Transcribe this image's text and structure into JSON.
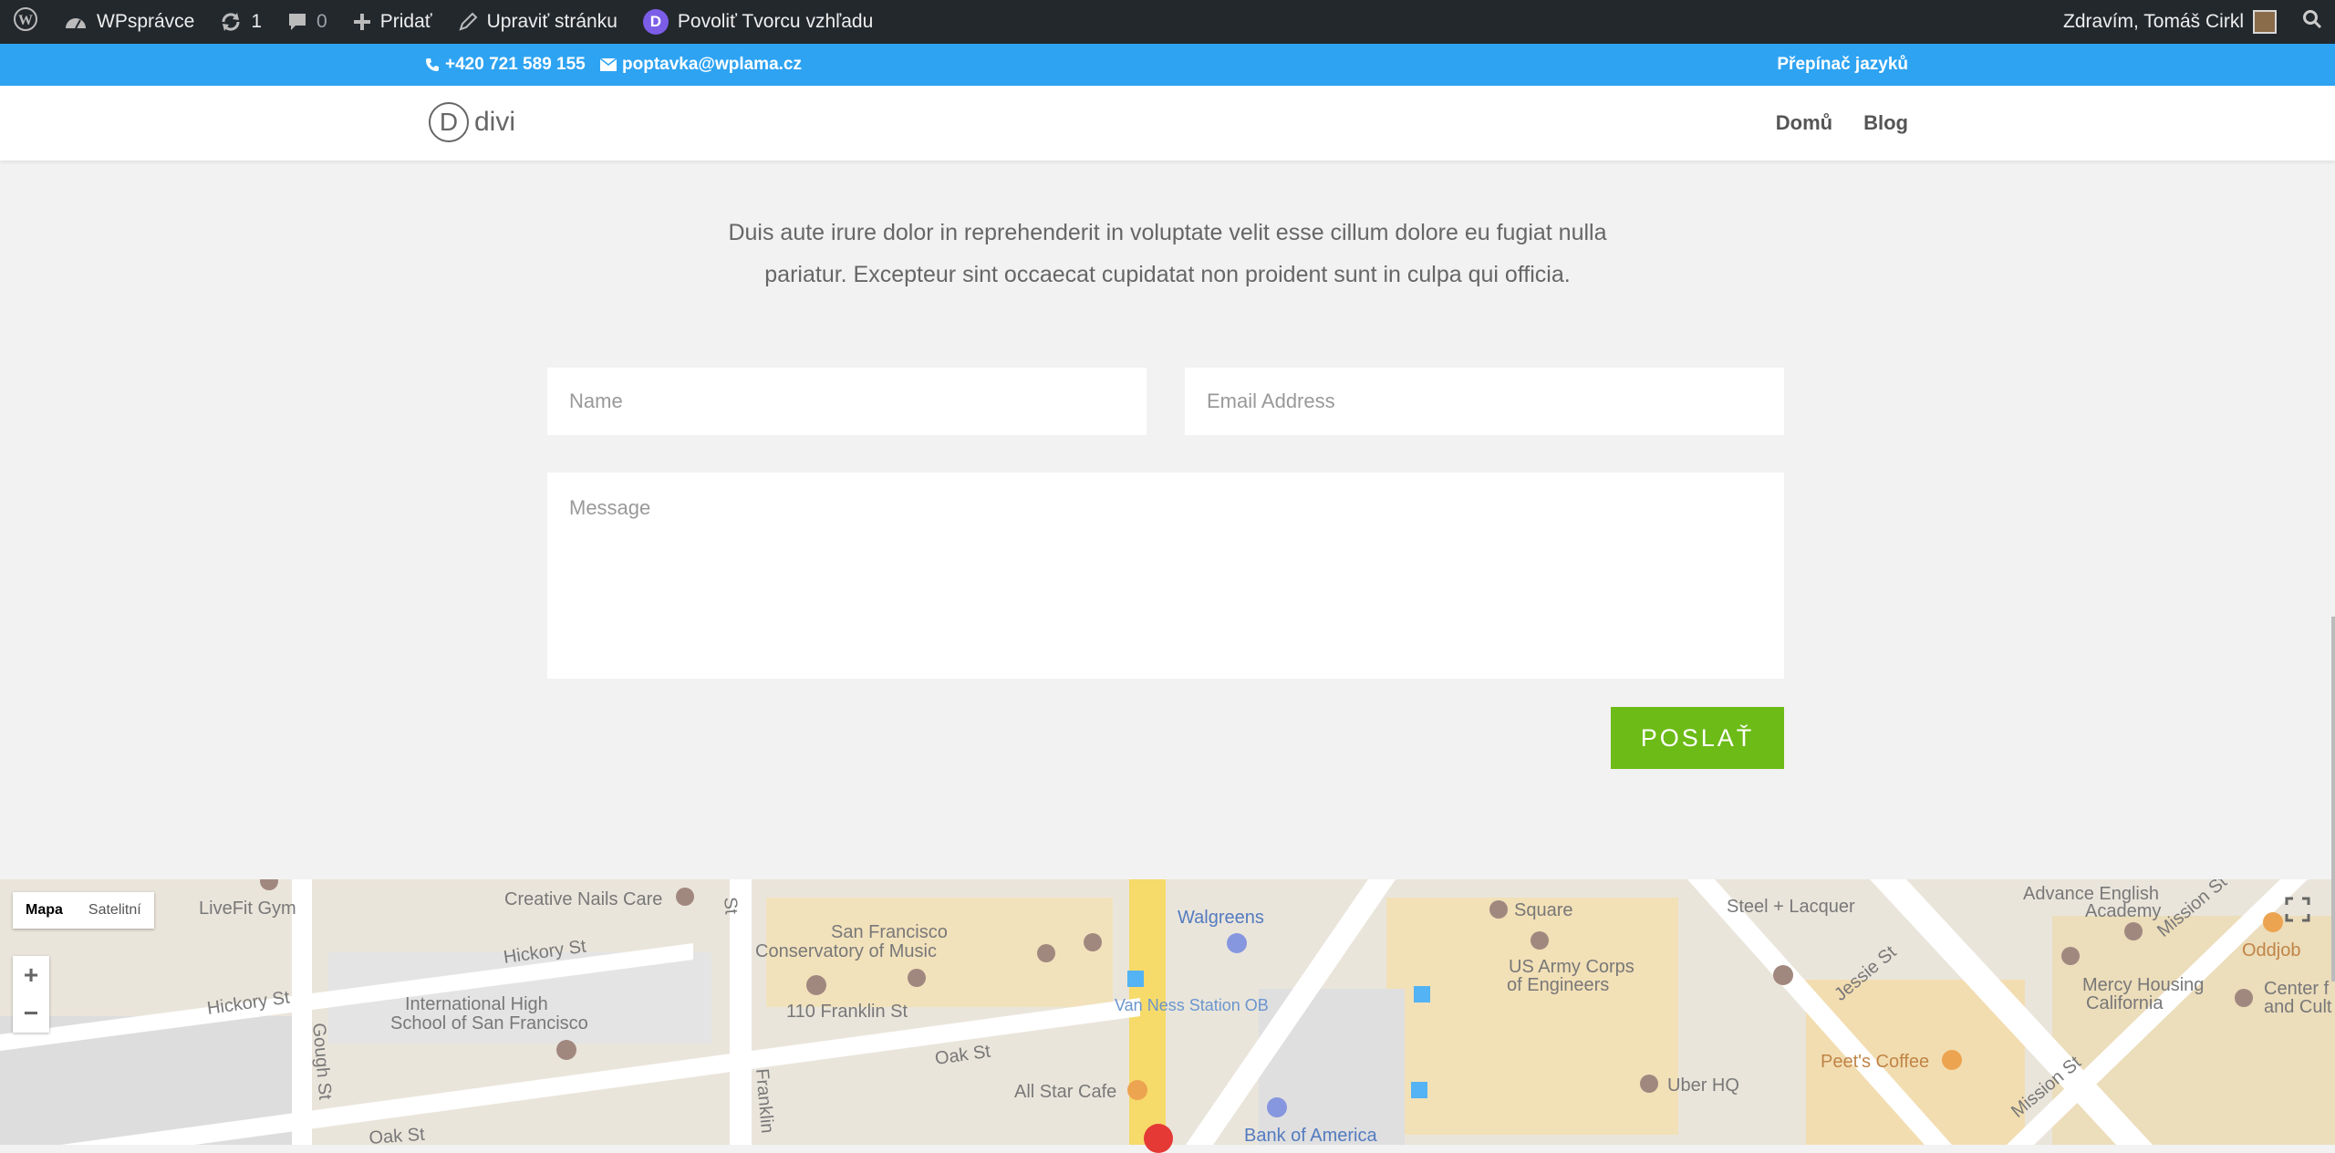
{
  "admin_bar": {
    "site_name": "WPsprávce",
    "updates_count": "1",
    "comments_count": "0",
    "new_label": "Pridať",
    "edit_label": "Upraviť stránku",
    "builder_label": "Povoliť Tvorcu vzhľadu",
    "builder_icon_letter": "D",
    "greeting": "Zdravím, Tomáš Cirkl"
  },
  "top_bar": {
    "phone": "+420 721 589 155",
    "email": "poptavka@wplama.cz",
    "language_switcher": "Přepínač jazyků"
  },
  "header": {
    "logo_mark": "D",
    "logo_text": "divi",
    "nav": [
      {
        "label": "Domů"
      },
      {
        "label": "Blog"
      }
    ]
  },
  "contact": {
    "intro_line1": "Duis aute irure dolor in reprehenderit in voluptate velit esse cillum dolore eu fugiat nulla",
    "intro_line2": "pariatur. Excepteur sint occaecat cupidatat non proident sunt in culpa qui officia.",
    "name_placeholder": "Name",
    "email_placeholder": "Email Address",
    "message_placeholder": "Message",
    "submit_label": "POSLAŤ"
  },
  "map": {
    "type_map": "Mapa",
    "type_satellite": "Satelitní",
    "zoom_in": "+",
    "zoom_out": "−",
    "labels": [
      "Creative Nails Care",
      "LiveFit Gym",
      "Hickory St",
      "Hickory St",
      "International High",
      "School of San Francisco",
      "Gough St",
      "Franklin",
      "San Francisco",
      "Conservatory of Music",
      "110 Franklin St",
      "Oak St",
      "Oak St",
      "All Star Cafe",
      "Walgreens",
      "Van Ness Station OB",
      "Bank of America",
      "Square",
      "US Army Corps",
      "of Engineers",
      "Uber HQ",
      "Steel + Lacquer",
      "Jessie St",
      "Peet's Coffee",
      "Advance English",
      "Academy",
      "Mercy Housing",
      "California",
      "Mission St",
      "Mission St",
      "Oddjob",
      "Center f",
      "and Cult",
      "St"
    ]
  },
  "colors": {
    "admin_bar": "#23282d",
    "top_bar": "#2ea3f2",
    "submit": "#6cbb17",
    "page_bg": "#f2f2f2"
  }
}
